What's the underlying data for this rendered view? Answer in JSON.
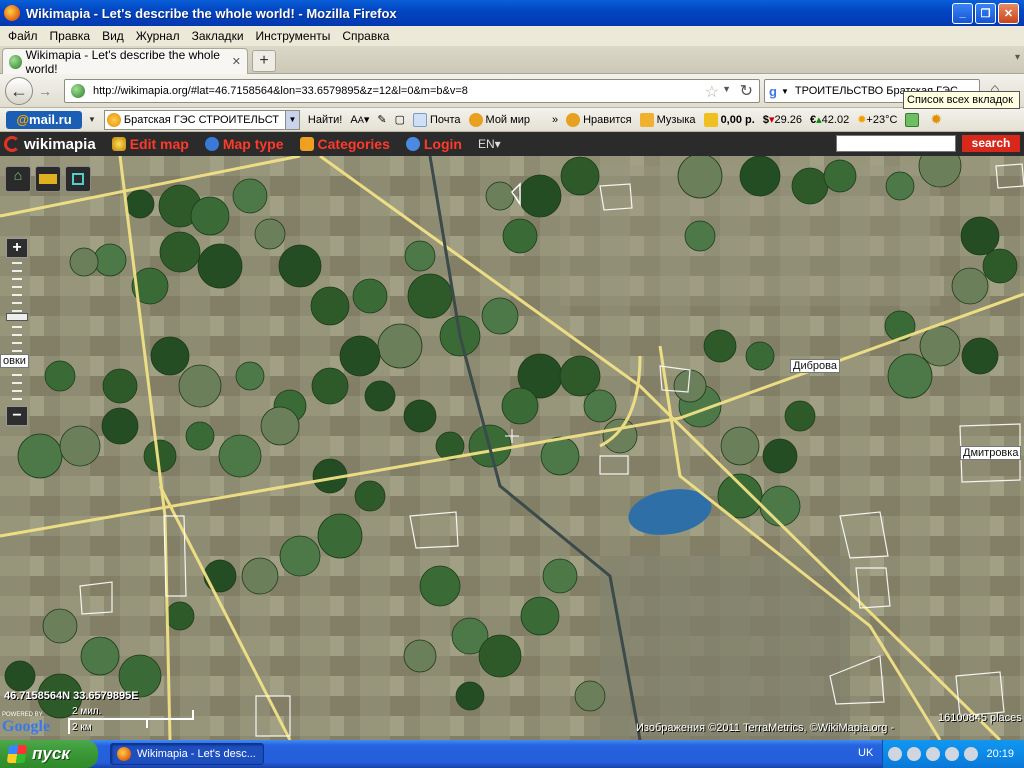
{
  "window": {
    "title": "Wikimapia - Let's describe the whole world! - Mozilla Firefox"
  },
  "menu": [
    "Файл",
    "Правка",
    "Вид",
    "Журнал",
    "Закладки",
    "Инструменты",
    "Справка"
  ],
  "tab": {
    "title": "Wikimapia - Let's describe the whole world!"
  },
  "url": "http://wikimapia.org/#lat=46.7158564&lon=33.6579895&z=12&l=0&m=b&v=8",
  "search_box": {
    "value": "ТРОИТЕЛЬСТВО Братская ГЭС"
  },
  "tooltip": "Список всех вкладок",
  "mailru": {
    "logo_at": "@",
    "logo_text": "mail.ru"
  },
  "toolbar": {
    "search_value": "Братская ГЭС СТРОИТЕЛЬСТ",
    "find_label": "Найти!",
    "mail_label": "Почта",
    "myworld_label": "Мой мир",
    "more_label": "»",
    "like_label": "Нравится",
    "music_label": "Музыка",
    "balance": "0,00 р.",
    "usd": "29.26",
    "eur": "42.02",
    "weather": "+23°C"
  },
  "wikimapia": {
    "logo": "wikimapia",
    "edit_map": "Edit map",
    "map_type": "Map type",
    "categories": "Categories",
    "login": "Login",
    "lang": "EN",
    "search_btn": "search"
  },
  "map": {
    "labels": {
      "dibrova": "Диброва",
      "dmitrovka": "Дмитровка",
      "left_cut": "овки"
    },
    "coords": "46.7158564N 33.6579895E",
    "scale_top": "2 мил.",
    "scale_bottom": "2 км",
    "attribution": "Изображения ©2011 TerraMetrics, ©WikiMapia.org -",
    "places_count": "16100845 places",
    "google": "Google",
    "powered": "POWERED BY"
  },
  "taskbar": {
    "start": "пуск",
    "active_window": "Wikimapia - Let's desc...",
    "lang": "UK",
    "clock": "20:19"
  },
  "colors": {
    "titlebar": "#0246c2",
    "wm_bar": "#2b2b2b",
    "wm_accent": "#ff3a2a",
    "road": "#f2e186",
    "field_green": "#2e5a2a"
  }
}
